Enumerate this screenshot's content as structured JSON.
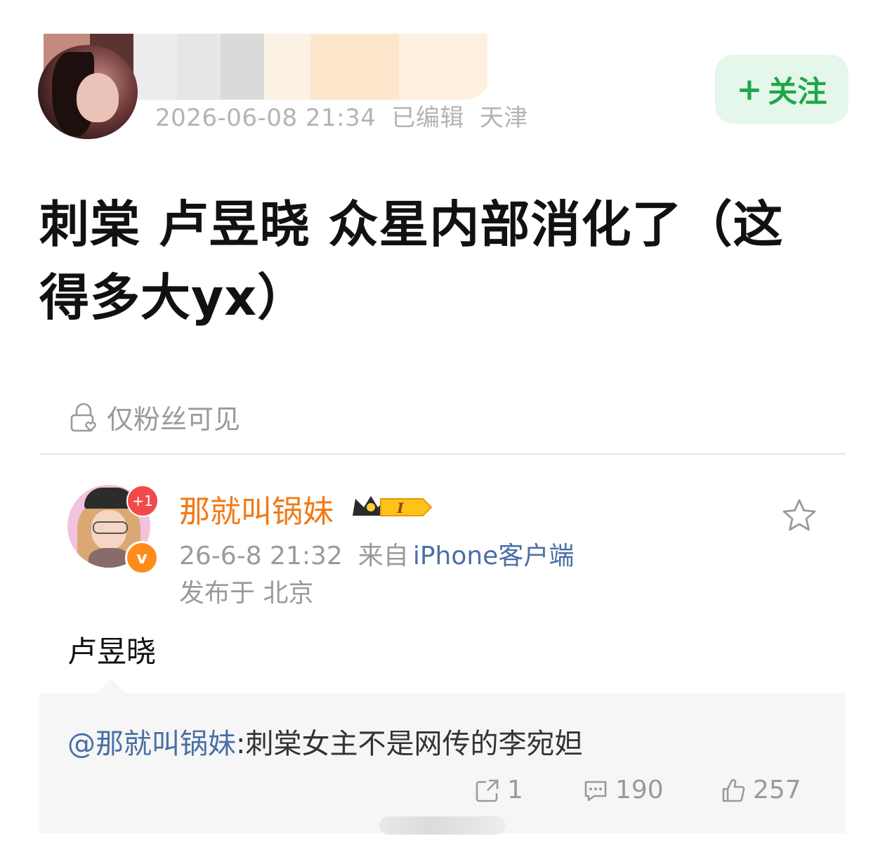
{
  "post": {
    "meta_time": "2026-06-08 21:34",
    "meta_edited": "已编辑",
    "meta_location": "天津",
    "follow_label": "关注",
    "follow_plus": "+",
    "text": "刺棠 卢昱晓 众星内部消化了（这得多大yx）",
    "visibility": "仅粉丝可见"
  },
  "comment": {
    "name": "那就叫锅妹",
    "badge_notif": "+1",
    "badge_verified": "v",
    "level_badge": "I",
    "time": "26-6-8 21:32",
    "from_label": "来自",
    "client": "iPhone客户端",
    "location": "发布于 北京",
    "text": "卢昱晓"
  },
  "quote": {
    "mention": "@那就叫锅妹",
    "text": ":刺棠女主不是网传的李宛妲"
  },
  "actions": {
    "repost_count": "1",
    "comment_count": "190",
    "like_count": "257"
  },
  "colors": {
    "follow_green": "#1fa74a",
    "follow_bg": "#e5f6ea",
    "username_orange": "#f07a18",
    "link_blue": "#4a6fa5",
    "meta_gray": "#9a9a9a"
  },
  "icons": [
    "lock-heart-icon",
    "crown-level-icon",
    "star-icon",
    "repost-icon",
    "comment-icon",
    "like-icon"
  ]
}
